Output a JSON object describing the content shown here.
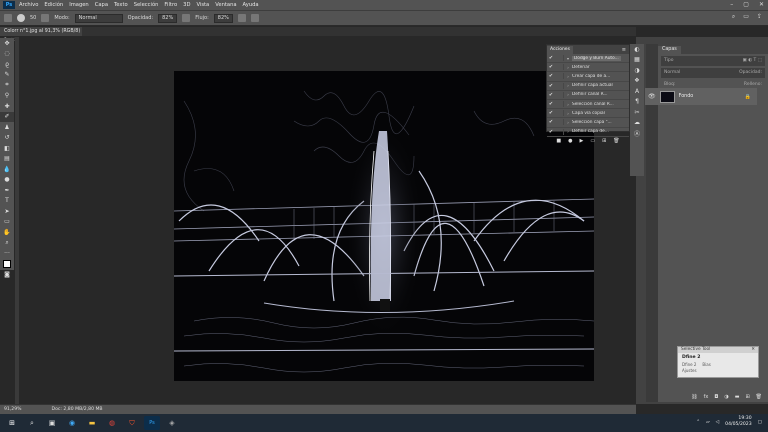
{
  "app": {
    "logo": "Ps"
  },
  "menu": [
    "Archivo",
    "Edición",
    "Imagen",
    "Capa",
    "Texto",
    "Selección",
    "Filtro",
    "3D",
    "Vista",
    "Ventana",
    "Ayuda"
  ],
  "options_bar": {
    "size_value": "50",
    "mode_label": "Modo:",
    "mode_value": "Normal",
    "opacity_label": "Opacidad:",
    "opacity_value": "82%",
    "flow_label": "Flujo:",
    "flow_value": "82%"
  },
  "document_tab": {
    "title": "Colorr n°1.jpg al 91,3% (RGB/8) *",
    "close": "×"
  },
  "actions_panel": {
    "title": "Acciones",
    "items": [
      {
        "label": "Dodge y Burn Auto...",
        "selected": true
      },
      {
        "label": "Deteriar"
      },
      {
        "label": "Crear capa de a..."
      },
      {
        "label": "Definir capa actual"
      },
      {
        "label": "Definir canal R..."
      },
      {
        "label": "Selección canal R..."
      },
      {
        "label": "Capa vía copiar"
      },
      {
        "label": "Selección capa \"..."
      },
      {
        "label": "Definir capa de..."
      }
    ]
  },
  "layers_panel": {
    "tabs": [
      "Capas"
    ],
    "kind_placeholder": "Tipo",
    "blend_mode": "Normal",
    "opacity_label": "Opacidad:",
    "lock_label": "Bloq:",
    "fill_label": "Relleno:",
    "layer_name": "Fondo"
  },
  "selective_tool": {
    "title": "Selective Tool",
    "name": "Dfine 2",
    "sub1": "Dfine 2",
    "sub2": "Bias",
    "adjust": "Ajustes"
  },
  "status_bar": {
    "zoom": "91,29%",
    "doc": "Doc: 2,80 MB/2,80 MB"
  },
  "taskbar": {
    "time": "19:30",
    "date": "04/05/2023"
  },
  "colors": {
    "accent": "#31a8ff",
    "panel": "#535353",
    "bg": "#282828"
  }
}
